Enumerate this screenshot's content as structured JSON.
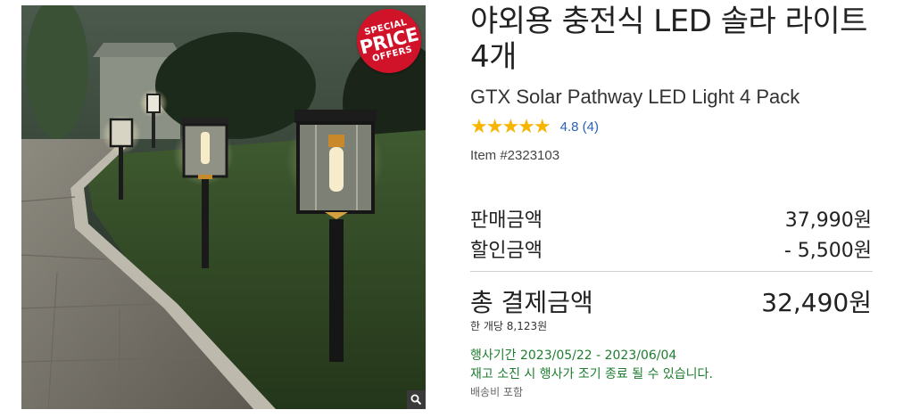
{
  "badge": {
    "line1": "SPECIAL",
    "line2": "PRICE",
    "line3": "OFFERS"
  },
  "product": {
    "title_ko": "야외용 충전식 LED 솔라 라이트 4개",
    "title_en": "GTX Solar Pathway LED Light 4 Pack",
    "stars": "★★★★★",
    "rating": 4.8,
    "rating_text": "4.8 (4)",
    "item_number": "Item #2323103"
  },
  "pricing": {
    "sale_label": "판매금액",
    "sale_value": "37,990원",
    "discount_label": "할인금액",
    "discount_value": "- 5,500원",
    "total_label": "총 결제금액",
    "total_value": "32,490원",
    "unit_price": "한 개당 8,123원"
  },
  "promo": {
    "period": "행사기간 2023/05/22 - 2023/06/04",
    "stock_note": "재고 소진 시 행사가 조기 종료 될 수 있습니다.",
    "shipping": "배송비 포함"
  },
  "icons": {
    "zoom": "magnifier-icon"
  },
  "colors": {
    "badge": "#d1132a",
    "stars": "#f7b500",
    "rating_link": "#2a62b5",
    "promo_text": "#1e7d2f"
  }
}
